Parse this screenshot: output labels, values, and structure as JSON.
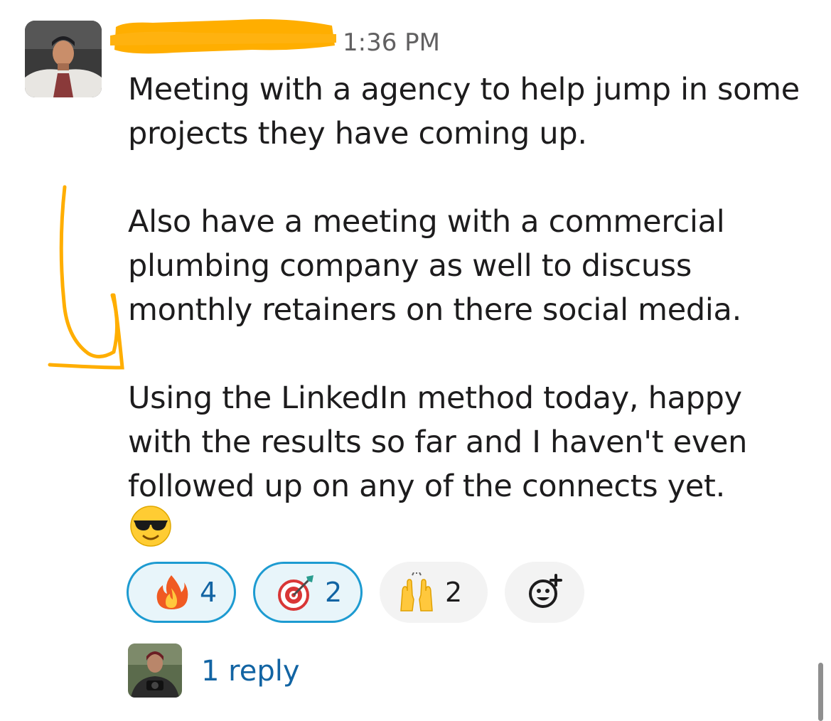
{
  "message": {
    "timestamp": "1:36 PM",
    "paragraphs": [
      "Meeting with a agency to help jump in some projects they have coming up.",
      "Also have a meeting with a commercial plumbing company as well to discuss monthly retainers on there social media.",
      "Using the LinkedIn method today, happy with the results so far and I haven't even followed up on any of the connects yet."
    ],
    "trailing_emoji": "sunglasses-emoji"
  },
  "reactions": [
    {
      "icon": "fire-emoji",
      "count": "4",
      "active": true
    },
    {
      "icon": "dart-emoji",
      "count": "2",
      "active": true
    },
    {
      "icon": "raised-hands-emoji",
      "count": "2",
      "active": false
    }
  ],
  "add_reaction": {
    "icon": "add-reaction-icon"
  },
  "thread": {
    "reply_label": "1 reply"
  },
  "colors": {
    "redaction": "#ffae00",
    "annotation_arrow": "#ffae00",
    "link": "#1264a3",
    "active_reaction_border": "#1d9bd1",
    "active_reaction_bg": "#e8f5fa"
  }
}
